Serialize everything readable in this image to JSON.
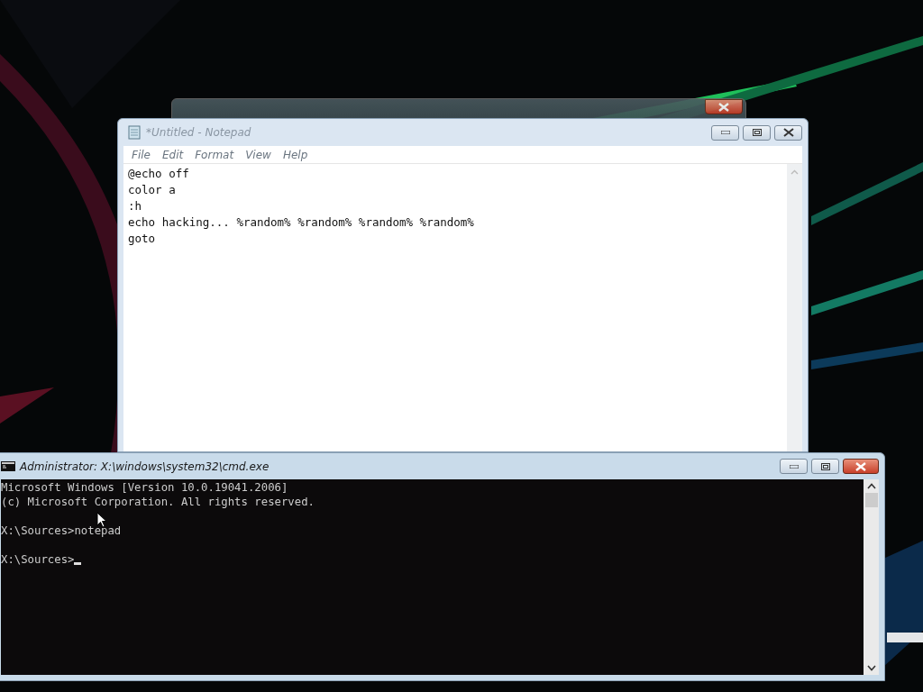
{
  "notepad": {
    "title": "*Untitled - Notepad",
    "menu": [
      "File",
      "Edit",
      "Format",
      "View",
      "Help"
    ],
    "lines": [
      "@echo off",
      "color a",
      ":h",
      "echo hacking... %random% %random% %random% %random%",
      "goto"
    ]
  },
  "cmd": {
    "title": "Administrator: X:\\windows\\system32\\cmd.exe",
    "paragraphs": [
      [
        "Microsoft Windows [Version 10.0.19041.2006]",
        "(c) Microsoft Corporation. All rights reserved."
      ],
      [
        "X:\\Sources>notepad"
      ],
      [
        "X:\\Sources>"
      ]
    ],
    "cursor": true
  }
}
